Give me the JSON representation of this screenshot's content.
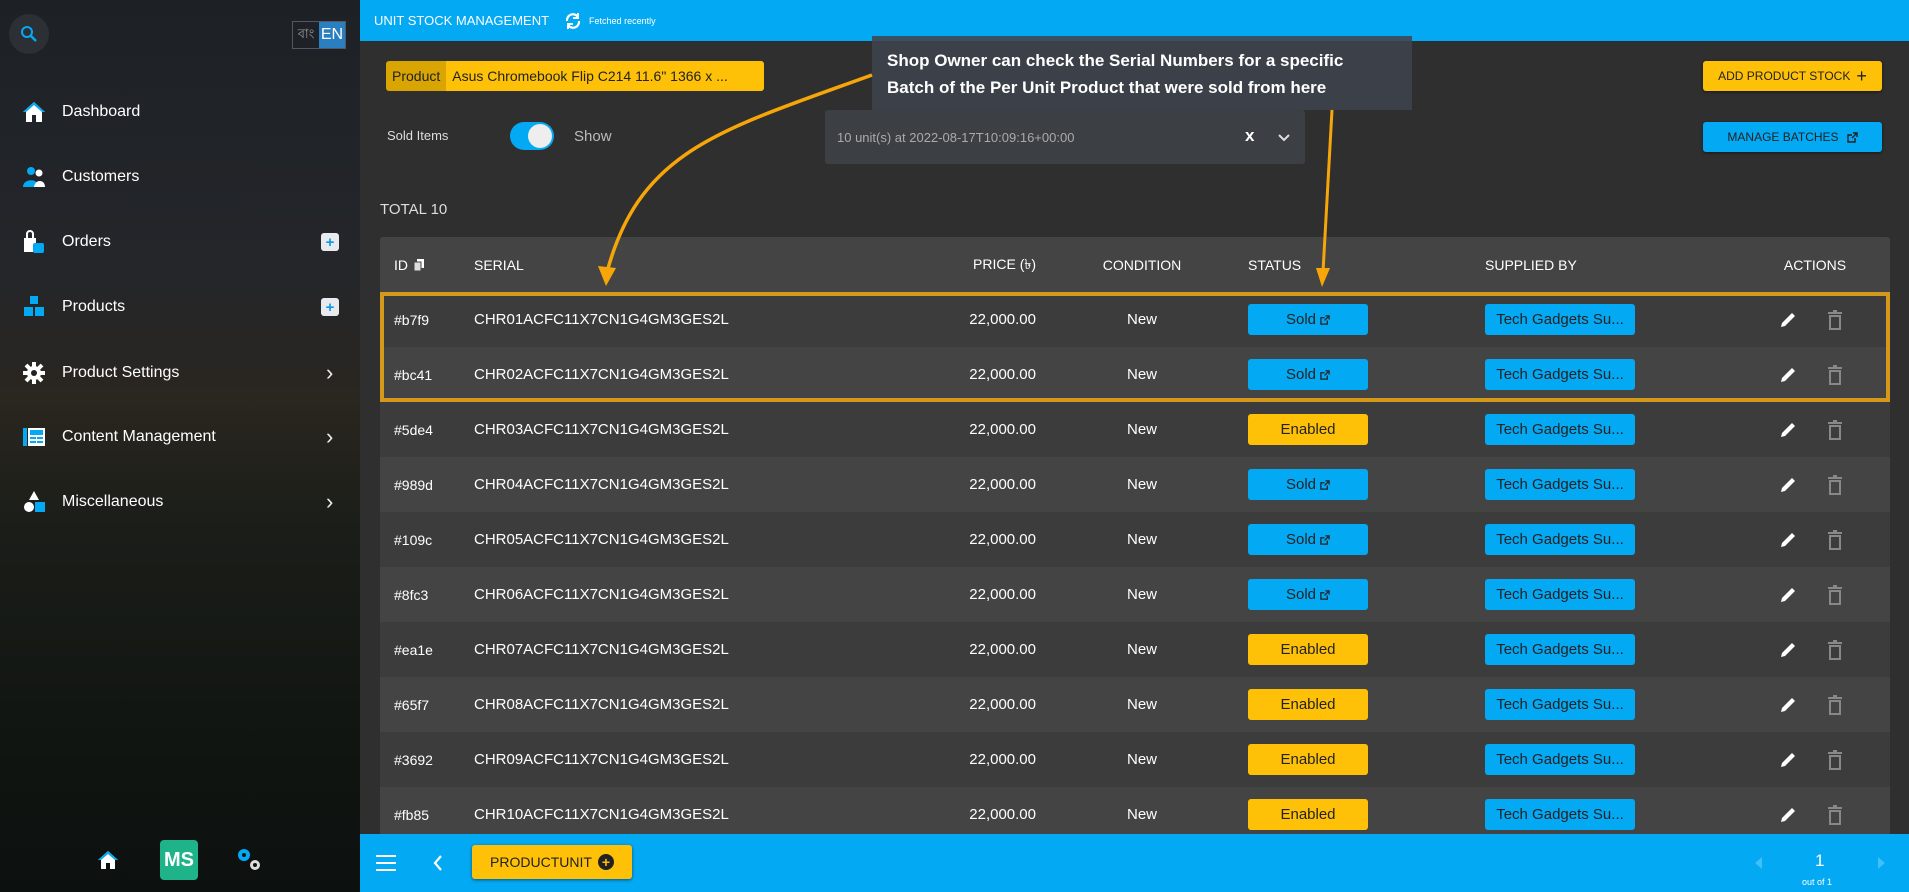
{
  "sidebar": {
    "lang": {
      "bn": "বাং",
      "en": "EN"
    },
    "items": [
      {
        "label": "Dashboard",
        "icon": "home-icon",
        "action": "none"
      },
      {
        "label": "Customers",
        "icon": "users-icon",
        "action": "none"
      },
      {
        "label": "Orders",
        "icon": "shopping-bag-icon",
        "action": "plus"
      },
      {
        "label": "Products",
        "icon": "boxes-icon",
        "action": "plus"
      },
      {
        "label": "Product Settings",
        "icon": "gear-icon",
        "action": "chevron"
      },
      {
        "label": "Content Management",
        "icon": "newspaper-icon",
        "action": "chevron"
      },
      {
        "label": "Miscellaneous",
        "icon": "shapes-icon",
        "action": "chevron"
      }
    ],
    "logo": "MS"
  },
  "header": {
    "title": "UNIT STOCK MANAGEMENT",
    "fetch_status": "Fetched recently"
  },
  "product": {
    "label": "Product",
    "value": "Asus Chromebook Flip C214 11.6\" 1366 x ..."
  },
  "sold_items": {
    "label": "Sold Items",
    "toggle_label": "Show",
    "on": true
  },
  "batch": {
    "value": "10 unit(s) at 2022-08-17T10:09:16+00:00",
    "clear": "x"
  },
  "buttons": {
    "add_stock": "ADD PRODUCT STOCK",
    "manage_batches": "MANAGE BATCHES"
  },
  "tooltip": {
    "line1": "Shop Owner can check the Serial Numbers for a specific",
    "line2": "Batch of the Per Unit Product that were sold from here"
  },
  "total": "TOTAL 10",
  "table": {
    "headers": {
      "id": "ID",
      "serial": "SERIAL",
      "price": "PRICE (৳)",
      "condition": "CONDITION",
      "status": "STATUS",
      "supplied_by": "SUPPLIED BY",
      "actions": "ACTIONS"
    },
    "rows": [
      {
        "id": "#b7f9",
        "serial": "CHR01ACFC11X7CN1G4GM3GES2L",
        "price": "22,000.00",
        "condition": "New",
        "status": "Sold",
        "supplier": "Tech Gadgets Su..."
      },
      {
        "id": "#bc41",
        "serial": "CHR02ACFC11X7CN1G4GM3GES2L",
        "price": "22,000.00",
        "condition": "New",
        "status": "Sold",
        "supplier": "Tech Gadgets Su..."
      },
      {
        "id": "#5de4",
        "serial": "CHR03ACFC11X7CN1G4GM3GES2L",
        "price": "22,000.00",
        "condition": "New",
        "status": "Enabled",
        "supplier": "Tech Gadgets Su..."
      },
      {
        "id": "#989d",
        "serial": "CHR04ACFC11X7CN1G4GM3GES2L",
        "price": "22,000.00",
        "condition": "New",
        "status": "Sold",
        "supplier": "Tech Gadgets Su..."
      },
      {
        "id": "#109c",
        "serial": "CHR05ACFC11X7CN1G4GM3GES2L",
        "price": "22,000.00",
        "condition": "New",
        "status": "Sold",
        "supplier": "Tech Gadgets Su..."
      },
      {
        "id": "#8fc3",
        "serial": "CHR06ACFC11X7CN1G4GM3GES2L",
        "price": "22,000.00",
        "condition": "New",
        "status": "Sold",
        "supplier": "Tech Gadgets Su..."
      },
      {
        "id": "#ea1e",
        "serial": "CHR07ACFC11X7CN1G4GM3GES2L",
        "price": "22,000.00",
        "condition": "New",
        "status": "Enabled",
        "supplier": "Tech Gadgets Su..."
      },
      {
        "id": "#65f7",
        "serial": "CHR08ACFC11X7CN1G4GM3GES2L",
        "price": "22,000.00",
        "condition": "New",
        "status": "Enabled",
        "supplier": "Tech Gadgets Su..."
      },
      {
        "id": "#3692",
        "serial": "CHR09ACFC11X7CN1G4GM3GES2L",
        "price": "22,000.00",
        "condition": "New",
        "status": "Enabled",
        "supplier": "Tech Gadgets Su..."
      },
      {
        "id": "#fb85",
        "serial": "CHR10ACFC11X7CN1G4GM3GES2L",
        "price": "22,000.00",
        "condition": "New",
        "status": "Enabled",
        "supplier": "Tech Gadgets Su..."
      }
    ]
  },
  "footer": {
    "model_button": "PRODUCTUNIT",
    "page": "1",
    "page_of": "out of 1"
  },
  "colors": {
    "accent": "#04a9f4",
    "warning": "#ffc107",
    "highlight": "#d4981a"
  }
}
